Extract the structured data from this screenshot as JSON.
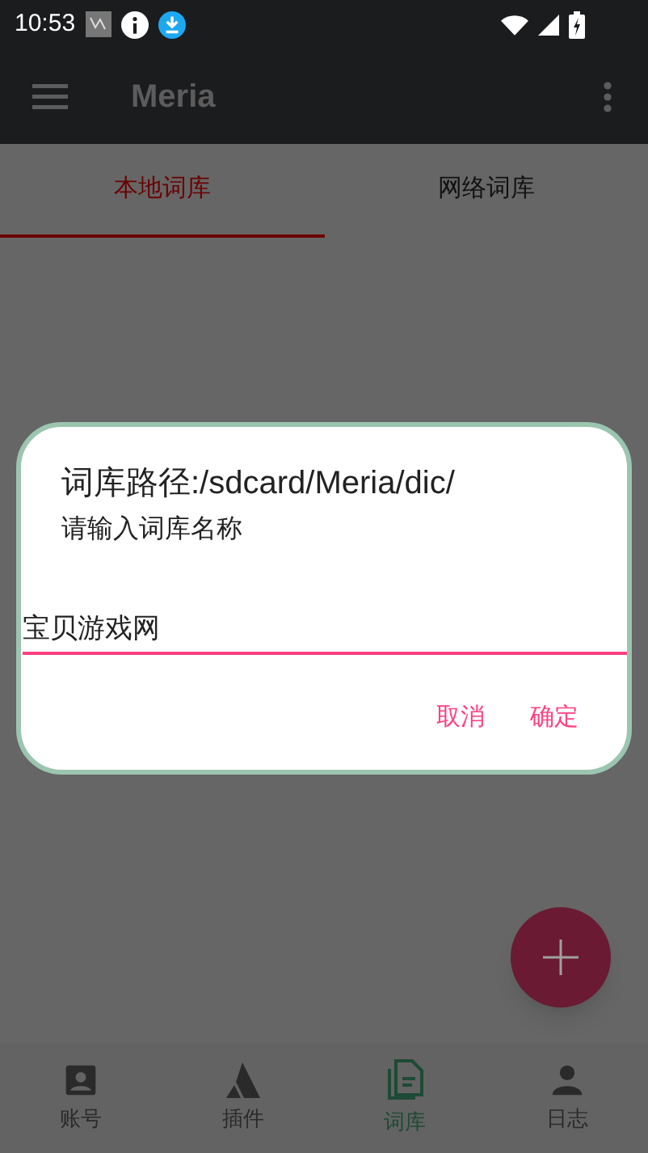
{
  "status_bar": {
    "time": "10:53"
  },
  "app_bar": {
    "title": "Meria"
  },
  "tabs": [
    {
      "label": "本地词库",
      "selected": true
    },
    {
      "label": "网络词库",
      "selected": false
    }
  ],
  "dialog": {
    "title": "词库路径:/sdcard/Meria/dic/",
    "message": "请输入词库名称",
    "input": {
      "value": "宝贝游戏网"
    },
    "buttons": [
      "取消",
      "确定"
    ]
  },
  "bottom_nav": [
    {
      "label": "账号",
      "kind": "account",
      "selected": false
    },
    {
      "label": "插件",
      "kind": "plugin",
      "selected": false
    },
    {
      "label": "词库",
      "kind": "dictionary",
      "selected": true
    },
    {
      "label": "日志",
      "kind": "log",
      "selected": false
    }
  ]
}
